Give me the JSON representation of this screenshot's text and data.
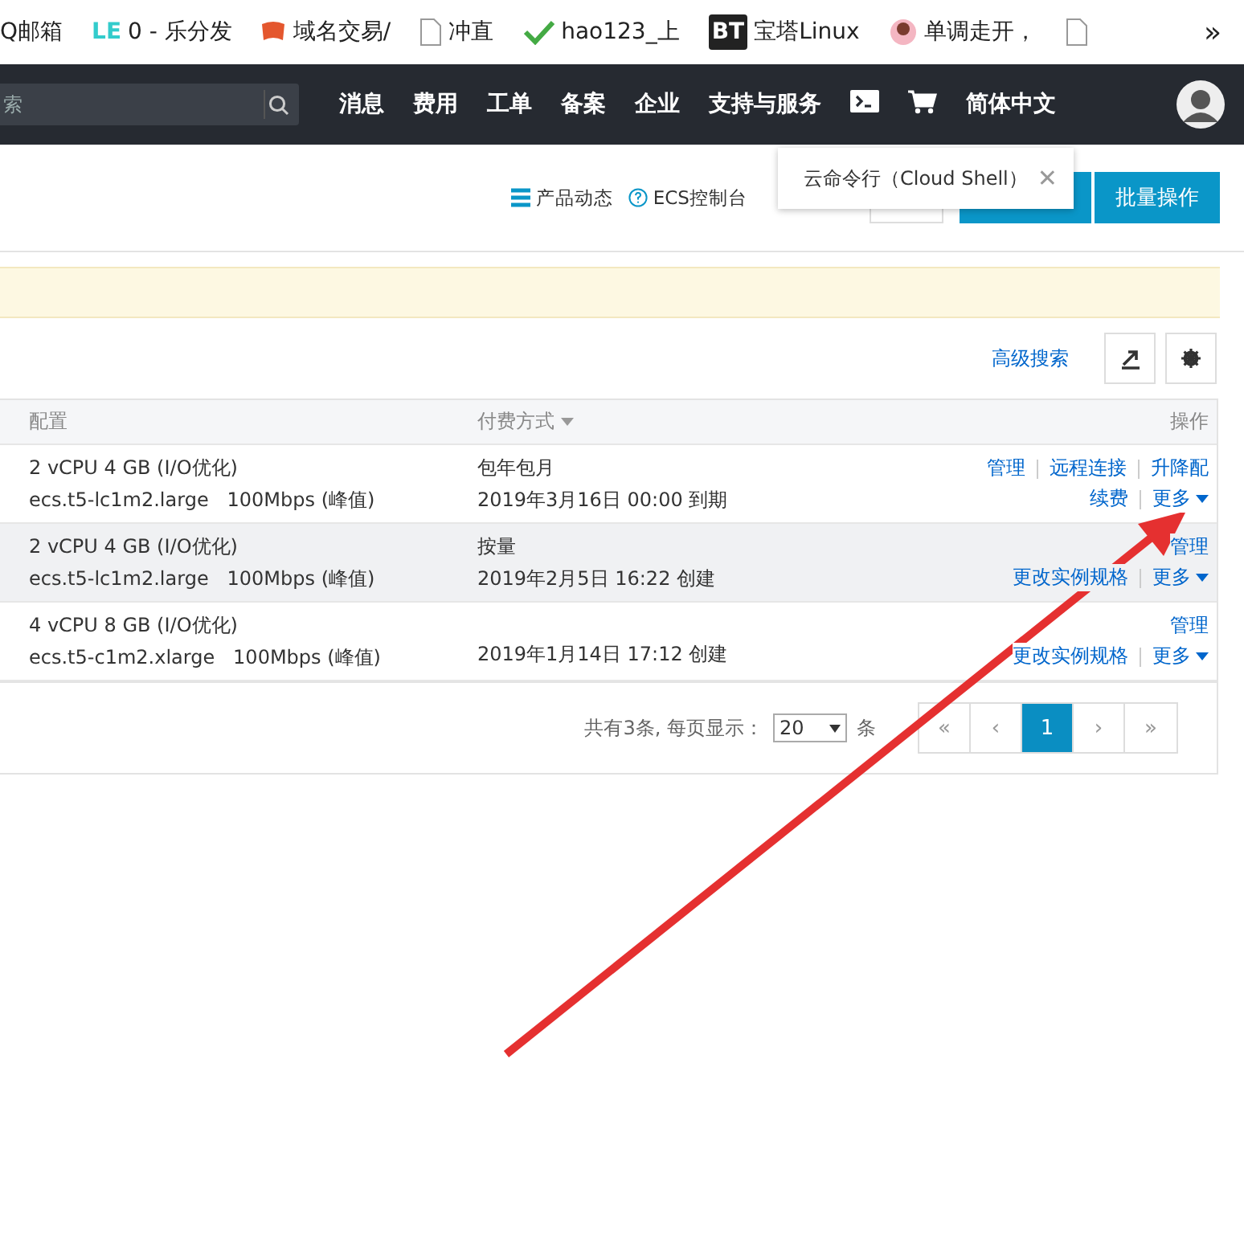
{
  "bookmarks": [
    {
      "kind": "plain",
      "label": "Q邮箱"
    },
    {
      "kind": "text",
      "badge": "LE",
      "label": "0 - 乐分发"
    },
    {
      "kind": "flag",
      "label": "域名交易/"
    },
    {
      "kind": "page",
      "label": "冲直"
    },
    {
      "kind": "check",
      "label": "hao123_上"
    },
    {
      "kind": "square",
      "badge": "BT",
      "label": "宝塔Linux"
    },
    {
      "kind": "avatar",
      "label": "单调走开，"
    }
  ],
  "bookmarks_more": "»",
  "nav": {
    "search_placeholder": "索",
    "items": [
      "消息",
      "费用",
      "工单",
      "备案",
      "企业",
      "支持与服务"
    ],
    "language": "简体中文"
  },
  "tooltip": {
    "text": "云命令行（Cloud Shell）",
    "close": "✕"
  },
  "toolbar": {
    "links": [
      {
        "kind": "list",
        "label": "产品动态"
      },
      {
        "kind": "help",
        "label": "ECS控制台"
      }
    ],
    "batch_button": "批量操作"
  },
  "search_bar": {
    "advanced_search": "高级搜索"
  },
  "table": {
    "columns": [
      {
        "label": "配置",
        "kind": "plain"
      },
      {
        "label": "付费方式",
        "kind": "sortable"
      },
      {
        "label": "操作",
        "kind": "plain"
      }
    ],
    "rows": [
      {
        "selected": false,
        "config": "2 vCPU 4 GB (I/O优化)",
        "spec": "ecs.t5-lc1m2.large   100Mbps (峰值)",
        "billing": "包年包月",
        "date": "2019年3月16日 00:00 到期",
        "actions": [
          [
            {
              "kind": "link",
              "label": "管理"
            },
            {
              "kind": "link",
              "label": "远程连接"
            },
            {
              "kind": "link",
              "label": "升降配"
            }
          ],
          [
            {
              "kind": "link",
              "label": "续费"
            },
            {
              "kind": "dropdown",
              "label": "更多"
            }
          ]
        ]
      },
      {
        "selected": true,
        "config": "2 vCPU 4 GB (I/O优化)",
        "spec": "ecs.t5-lc1m2.large   100Mbps (峰值)",
        "billing": "按量",
        "date": "2019年2月5日 16:22 创建",
        "actions": [
          [
            {
              "kind": "link",
              "label": "管理"
            }
          ],
          [
            {
              "kind": "link",
              "label": "更改实例规格"
            },
            {
              "kind": "dropdown",
              "label": "更多"
            }
          ]
        ]
      },
      {
        "selected": false,
        "config": "4 vCPU 8 GB (I/O优化)",
        "spec": "ecs.t5-c1m2.xlarge   100Mbps (峰值)",
        "date": "2019年1月14日 17:12 创建",
        "actions": [
          [
            {
              "kind": "link",
              "label": "管理"
            }
          ],
          [
            {
              "kind": "link",
              "label": "更改实例规格"
            },
            {
              "kind": "dropdown",
              "label": "更多"
            }
          ]
        ]
      }
    ]
  },
  "pagination": {
    "summary": "共有3条, 每页显示：",
    "page_size": "20",
    "unit": "条",
    "pages": [
      {
        "label": "«",
        "selected": false
      },
      {
        "label": "‹",
        "selected": false
      },
      {
        "label": "1",
        "selected": true
      },
      {
        "label": "›",
        "selected": false
      },
      {
        "label": "»",
        "selected": false
      }
    ]
  }
}
